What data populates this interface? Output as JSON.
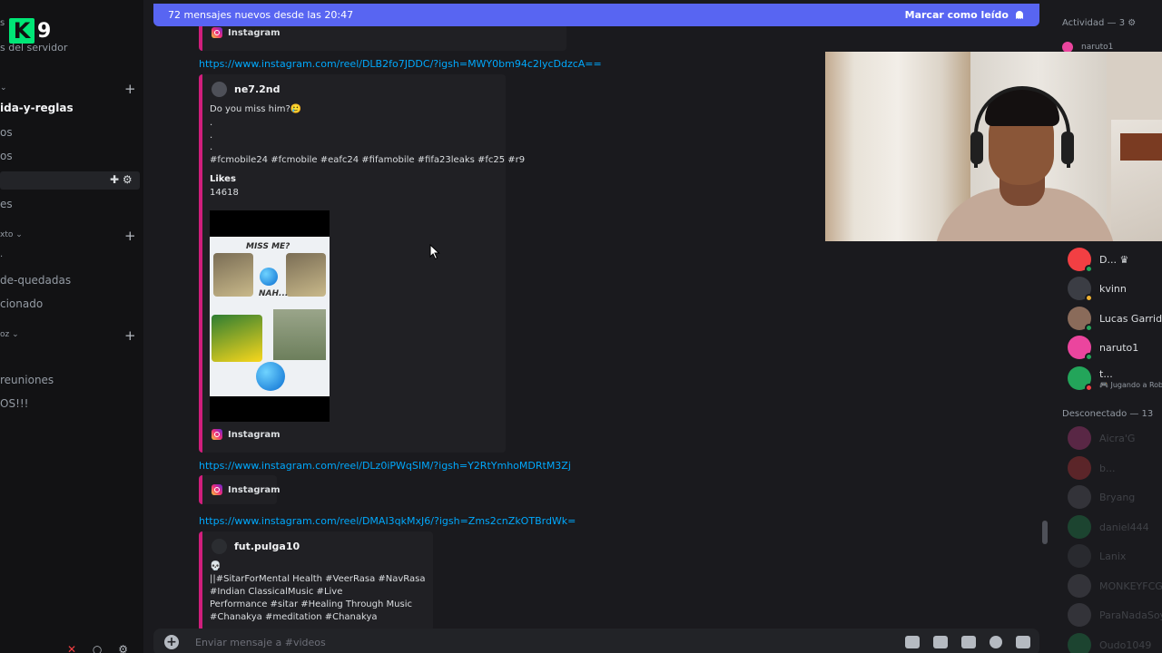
{
  "sidebar": {
    "logo_k": "K",
    "logo_n": "9",
    "logo_s": "s",
    "subtitle": "s del servidor",
    "channels": [
      {
        "label": "ida-y-reglas"
      },
      {
        "label": "os"
      },
      {
        "label": "os"
      },
      {
        "label": "es"
      },
      {
        "label": "de-quedadas"
      },
      {
        "label": "cionado"
      },
      {
        "label": "reuniones"
      },
      {
        "label": "OS!!!"
      }
    ],
    "categories": [
      {
        "label": "xto ⌄"
      },
      {
        "label": "oz ⌄"
      }
    ],
    "plus": "+",
    "row_icons": "✚ ⚙"
  },
  "banner": {
    "text": "72 mensajes nuevos desde las 20:47",
    "mark_read": "Marcar como leído"
  },
  "messages": {
    "footer_label": "Instagram",
    "link1": "https://www.instagram.com/reel/DLB2fo7JDDC/?igsh=MWY0bm94c2lycDdzcA==",
    "embed1": {
      "author": "ne7.2nd",
      "line1": "Do you miss him?🥲",
      "line2": ".",
      "line3": ".",
      "line4": ".",
      "hashtags": "#fcmobile24 #fcmobile #eafc24 #fifamobile #fifa23leaks #fc25 #r9",
      "likes_label": "Likes",
      "likes_value": "14618",
      "thumb_title": "MISS ME?",
      "thumb_nah": "NAH..."
    },
    "link2": "https://www.instagram.com/reel/DLz0iPWqSIM/?igsh=Y2RtYmhoMDRtM3Zj",
    "link3": "https://www.instagram.com/reel/DMAI3qkMxJ6/?igsh=Zms2cnZkOTBrdWk=",
    "embed3": {
      "author": "fut.pulga10",
      "line1": "💀",
      "line2": "||#SitarForMental Health #VeerRasa #NavRasa",
      "line3": "#Indian ClassicalMusic #Live",
      "line4": "Performance #sitar #Healing Through Music",
      "line5": "#Chanakya #meditation #Chanakya"
    }
  },
  "input": {
    "plus": "+",
    "placeholder": "Enviar mensaje a #videos"
  },
  "members": {
    "activity_header": "Actividad — 3 ⚙",
    "activity_peek": "naruto1",
    "online": [
      {
        "name": "D... ♛",
        "status": "online",
        "color": "#f23f43"
      },
      {
        "name": "kvinn",
        "status": "idle",
        "color": "#3b3d44"
      },
      {
        "name": "Lucas Garrido",
        "status": "online",
        "color": "#8a6b5a"
      },
      {
        "name": "naruto1",
        "status": "online",
        "color": "#eb459e"
      },
      {
        "name": "t...",
        "sub": "🎮 Jugando a Roblox",
        "status": "dnd",
        "color": "#23a55a"
      }
    ],
    "offline_header": "Desconectado — 13",
    "offline": [
      {
        "name": "Aicra'G",
        "color": "#eb459e"
      },
      {
        "name": "b...",
        "color": "#f23f43"
      },
      {
        "name": "Bryang",
        "color": "#6d6f78"
      },
      {
        "name": "daniel444",
        "color": "#23a55a"
      },
      {
        "name": "Lanix",
        "color": "#4e5058"
      },
      {
        "name": "MONKEYFCG",
        "color": "#6d6f78"
      },
      {
        "name": "ParaNadaSoy",
        "color": "#6d6f78"
      },
      {
        "name": "Oudo1049",
        "color": "#23a55a"
      }
    ]
  }
}
